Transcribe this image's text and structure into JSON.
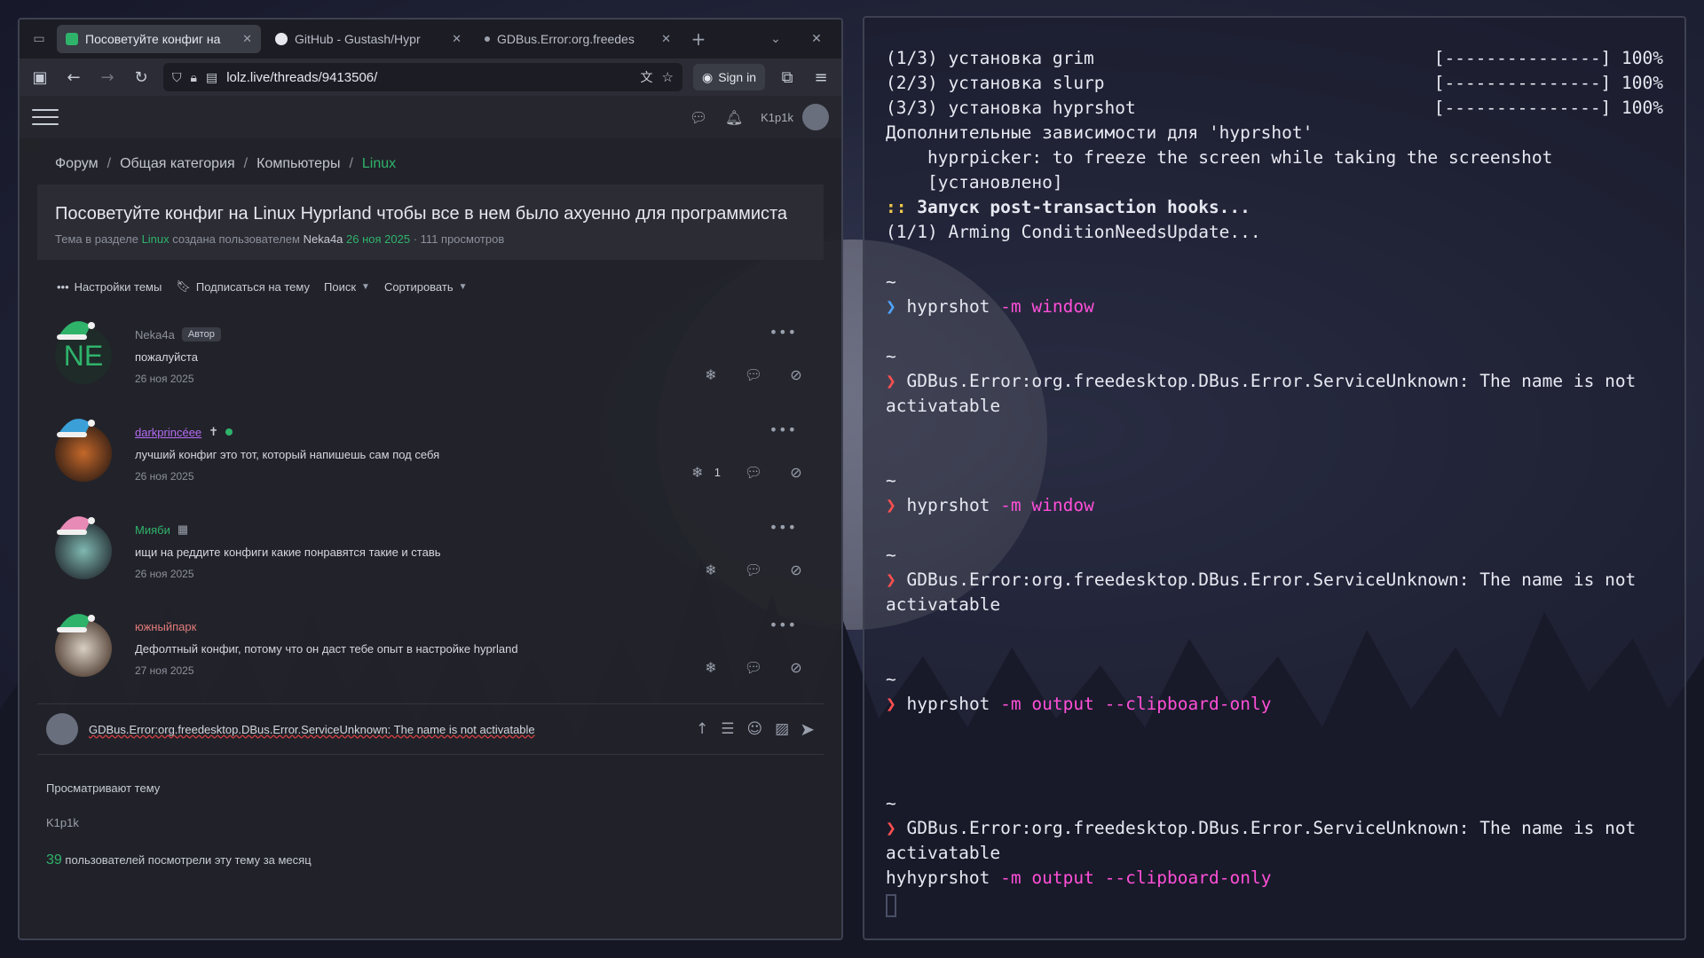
{
  "browser": {
    "tabs": [
      {
        "title": "Посоветуйте конфиг на",
        "active": true
      },
      {
        "title": "GitHub - Gustash/Hypr",
        "active": false
      },
      {
        "title": "GDBus.Error:org.freedes",
        "active": false
      }
    ],
    "url": "lolz.live/threads/9413506/",
    "signin_label": "Sign in",
    "header_user": "K1p1k"
  },
  "forum": {
    "breadcrumb": [
      "Форум",
      "Общая категория",
      "Компьютеры",
      "Linux"
    ],
    "thread": {
      "title": "Посоветуйте конфиг на Linux Hyprland чтобы все в нем было ахуенно для программиста",
      "meta_prefix": "Тема в разделе",
      "meta_section": "Linux",
      "meta_created_by": "создана пользователем",
      "meta_author": "Neka4a",
      "meta_date": "26 ноя 2025",
      "meta_views": "· 111 просмотров"
    },
    "actions": {
      "settings": "Настройки темы",
      "subscribe": "Подписаться на тему",
      "search": "Поиск",
      "sort": "Сортировать"
    },
    "posts": [
      {
        "author": "Neka4a",
        "author_color": "#8c909b",
        "badge": "Автор",
        "avatar_text": "NE",
        "text": "пожалуйста",
        "date": "26 ноя 2025",
        "likes": ""
      },
      {
        "author": "darkprincéee",
        "author_color": "#b56cf5",
        "badge": "",
        "avatar_text": "",
        "text": "лучший конфиг это тот, который напишешь сам под себя",
        "date": "26 ноя 2025",
        "likes": "1"
      },
      {
        "author": "Мияби",
        "author_color": "#2fb36b",
        "badge": "",
        "avatar_text": "",
        "text": "ищи на реддите конфиги какие понравятся такие и ставь",
        "date": "26 ноя 2025",
        "likes": ""
      },
      {
        "author": "южныйпарк",
        "author_color": "#e07a7a",
        "badge": "",
        "avatar_text": "",
        "text": "Дефолтный конфиг, потому что он даст тебе опыт в настройке hyprland",
        "date": "27 ноя 2025",
        "likes": ""
      }
    ],
    "reply_value": "GDBus.Error:org.freedesktop.DBus.Error.ServiceUnknown: The name is not activatable",
    "viewers_title": "Просматривают тему",
    "viewers_list": "K1p1k",
    "viewers_count": "39",
    "viewers_count_text": "пользователей посмотрели эту тему за месяц"
  },
  "terminal": {
    "progress": [
      {
        "label": "(1/3) установка grim",
        "bar": "[---------------] 100%"
      },
      {
        "label": "(2/3) установка slurp",
        "bar": "[---------------] 100%"
      },
      {
        "label": "(3/3) установка hyprshot",
        "bar": "[---------------] 100%"
      }
    ],
    "deps_header": "Дополнительные зависимости для 'hyprshot'",
    "deps_line1": "    hyprpicker: to freeze the screen while taking the screenshot",
    "deps_line2": "    [установлено]",
    "hooks_prefix": "::",
    "hooks_text": " Запуск post-transaction hooks...",
    "arming": "(1/1) Arming ConditionNeedsUpdate...",
    "tilde": "~",
    "prompt_symbol": "❯",
    "cmd_name": "hyprshot",
    "cmd_m": "-m",
    "arg_window": "window",
    "arg_output": "output",
    "arg_clipboard": "--clipboard-only",
    "err_line1": "GDBus.Error:org.freedesktop.DBus.Error.ServiceUnknown: The name is not",
    "err_line2": "activatable",
    "last_prefix": "hy"
  }
}
